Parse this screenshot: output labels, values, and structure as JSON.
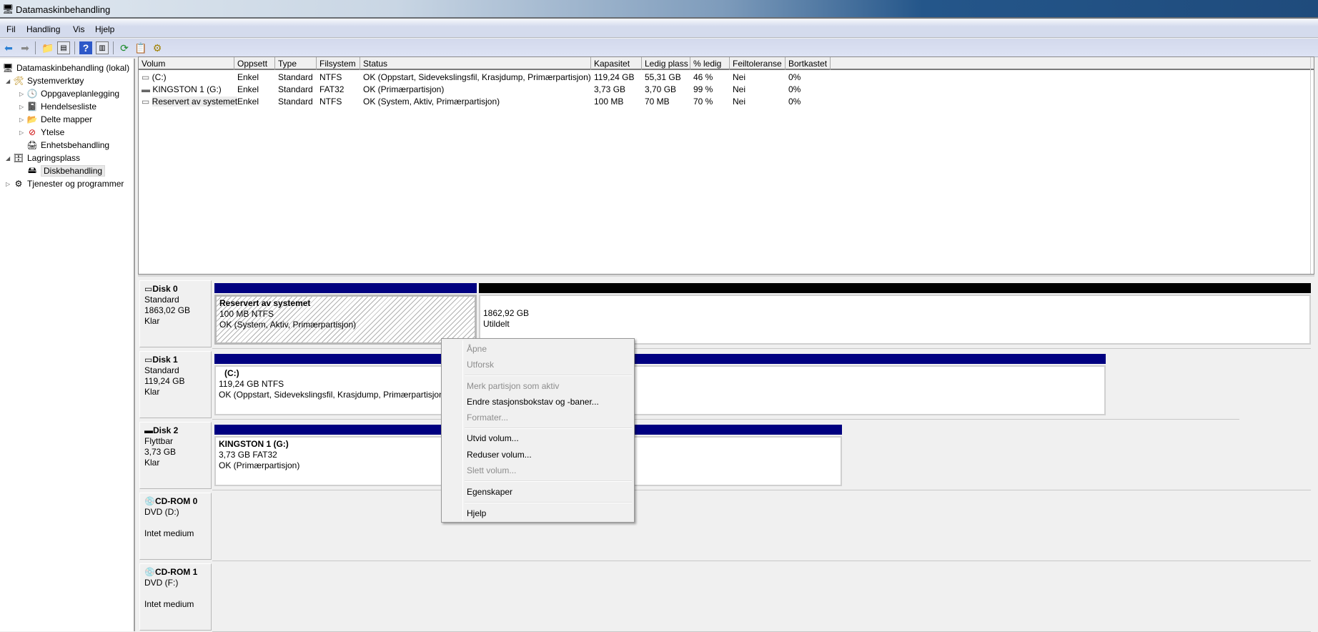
{
  "window": {
    "title": "Datamaskinbehandling"
  },
  "menu": [
    "Fil",
    "Handling",
    "Vis",
    "Hjelp"
  ],
  "toolbar": {
    "icons": [
      "back-icon",
      "forward-icon",
      "up-folder-icon",
      "show-hide-tree-icon",
      "help-icon",
      "show-hide-action-pane-icon",
      "refresh-icon",
      "properties-icon",
      "settings-icon"
    ]
  },
  "tree": {
    "root": "Datamaskinbehandling (lokal)",
    "items": [
      {
        "label": "Systemverktøy",
        "level": 1,
        "expand": "open"
      },
      {
        "label": "Oppgaveplanlegging",
        "level": 2,
        "expand": "closed"
      },
      {
        "label": "Hendelsesliste",
        "level": 2,
        "expand": "closed"
      },
      {
        "label": "Delte mapper",
        "level": 2,
        "expand": "closed"
      },
      {
        "label": "Ytelse",
        "level": 2,
        "expand": "closed"
      },
      {
        "label": "Enhetsbehandling",
        "level": 2,
        "expand": "none"
      },
      {
        "label": "Lagringsplass",
        "level": 1,
        "expand": "open"
      },
      {
        "label": "Diskbehandling",
        "level": 2,
        "expand": "none",
        "selected": true
      },
      {
        "label": "Tjenester og programmer",
        "level": 1,
        "expand": "closed"
      }
    ]
  },
  "volume_list": {
    "columns": [
      "Volum",
      "Oppsett",
      "Type",
      "Filsystem",
      "Status",
      "Kapasitet",
      "Ledig plass",
      "% ledig",
      "Feiltoleranse",
      "Bortkastet"
    ],
    "rows": [
      [
        "(C:)",
        "Enkel",
        "Standard",
        "NTFS",
        "OK (Oppstart, Sidevekslingsfil, Krasjdump, Primærpartisjon)",
        "119,24 GB",
        "55,31 GB",
        "46 %",
        "Nei",
        "0%"
      ],
      [
        "KINGSTON 1 (G:)",
        "Enkel",
        "Standard",
        "FAT32",
        "OK (Primærpartisjon)",
        "3,73 GB",
        "3,70 GB",
        "99 %",
        "Nei",
        "0%"
      ],
      [
        "Reservert av systemet",
        "Enkel",
        "Standard",
        "NTFS",
        "OK (System, Aktiv, Primærpartisjon)",
        "100 MB",
        "70 MB",
        "70 %",
        "Nei",
        "0%"
      ]
    ]
  },
  "disks": [
    {
      "name": "Disk 0",
      "type": "Standard",
      "size": "1863,02 GB",
      "state": "Klar",
      "partitions": [
        {
          "title": "Reservert av systemet",
          "size": "100 MB NTFS",
          "status": "OK (System, Aktiv, Primærpartisjon)",
          "bar_color": "#000080"
        },
        {
          "title": "",
          "size": "1862,92 GB",
          "status": "Utildelt",
          "bar_color": "#000000"
        }
      ]
    },
    {
      "name": "Disk 1",
      "type": "Standard",
      "size": "119,24 GB",
      "state": "Klar",
      "partitions": [
        {
          "title": "(C:)",
          "size": "119,24 GB NTFS",
          "status": "OK (Oppstart, Sidevekslingsfil, Krasjdump, Primærpartisjon)",
          "bar_color": "#000080"
        }
      ]
    },
    {
      "name": "Disk 2",
      "type": "Flyttbar",
      "size": "3,73 GB",
      "state": "Klar",
      "partitions": [
        {
          "title": "KINGSTON 1  (G:)",
          "size": "3,73 GB FAT32",
          "status": "OK (Primærpartisjon)",
          "bar_color": "#000080"
        }
      ]
    },
    {
      "name": "CD-ROM 0",
      "type": "DVD (D:)",
      "state": "Intet medium"
    },
    {
      "name": "CD-ROM 1",
      "type": "DVD (F:)",
      "state": "Intet medium"
    }
  ],
  "context_menu": [
    {
      "label": "Åpne",
      "enabled": false
    },
    {
      "label": "Utforsk",
      "enabled": false
    },
    {
      "separator": true
    },
    {
      "label": "Merk partisjon som aktiv",
      "enabled": false
    },
    {
      "label": "Endre stasjonsbokstav og -baner...",
      "enabled": true
    },
    {
      "label": "Formater...",
      "enabled": false
    },
    {
      "separator": true
    },
    {
      "label": "Utvid volum...",
      "enabled": true
    },
    {
      "label": "Reduser volum...",
      "enabled": true
    },
    {
      "label": "Slett volum...",
      "enabled": false
    },
    {
      "separator": true
    },
    {
      "label": "Egenskaper",
      "enabled": true
    },
    {
      "separator": true
    },
    {
      "label": "Hjelp",
      "enabled": true
    }
  ]
}
